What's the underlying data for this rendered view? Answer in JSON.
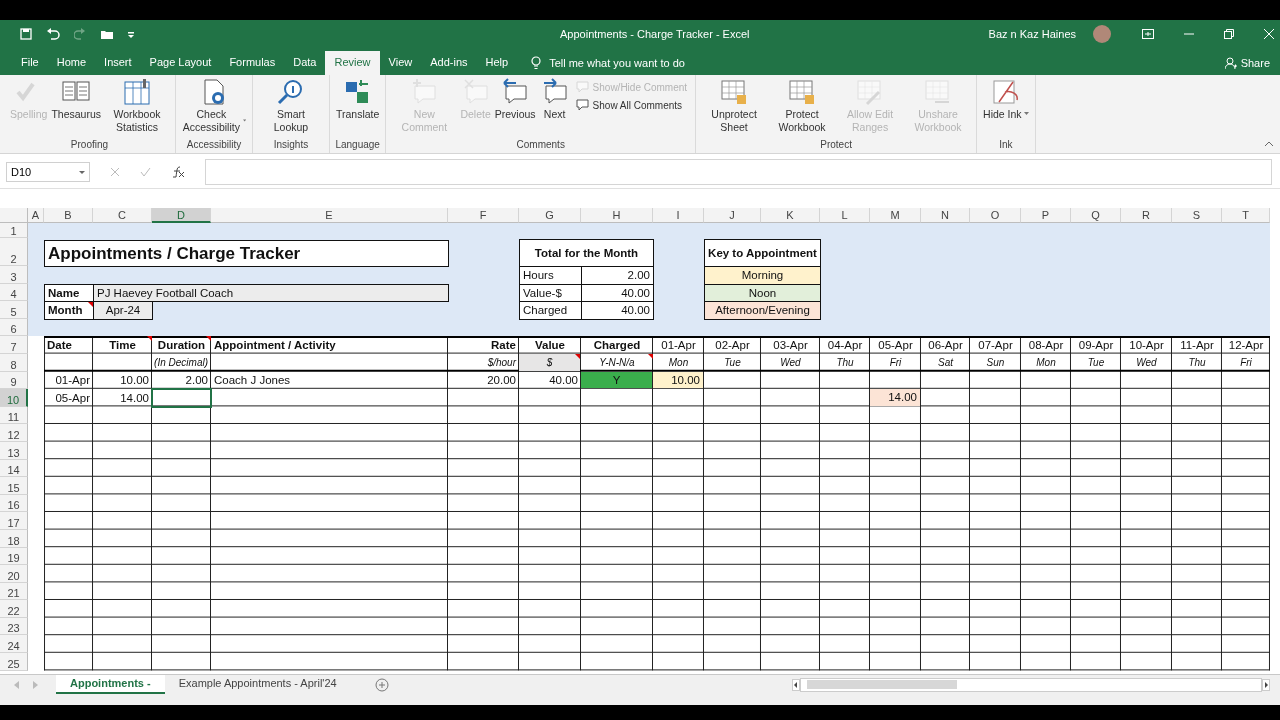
{
  "window": {
    "title": "Appointments - Charge Tracker  -  Excel",
    "user": "Baz n Kaz Haines"
  },
  "menu": {
    "tabs": [
      {
        "label": "File",
        "selected": false
      },
      {
        "label": "Home",
        "selected": false
      },
      {
        "label": "Insert",
        "selected": false
      },
      {
        "label": "Page Layout",
        "selected": false
      },
      {
        "label": "Formulas",
        "selected": false
      },
      {
        "label": "Data",
        "selected": false
      },
      {
        "label": "Review",
        "selected": true
      },
      {
        "label": "View",
        "selected": false
      },
      {
        "label": "Add-ins",
        "selected": false
      },
      {
        "label": "Help",
        "selected": false
      }
    ],
    "tell_me": "Tell me what you want to do",
    "share": "Share"
  },
  "ribbon": {
    "groups": [
      {
        "label": "Proofing",
        "buttons": [
          {
            "label": "Spelling",
            "kind": "large",
            "disabled": true
          },
          {
            "label": "Thesaurus",
            "kind": "large",
            "disabled": false
          },
          {
            "label": "Workbook Statistics",
            "kind": "large",
            "disabled": false
          }
        ]
      },
      {
        "label": "Accessibility",
        "buttons": [
          {
            "label": "Check Accessibility",
            "kind": "large",
            "disabled": false,
            "dropdown": true
          }
        ]
      },
      {
        "label": "Insights",
        "buttons": [
          {
            "label": "Smart Lookup",
            "kind": "large",
            "disabled": false
          }
        ]
      },
      {
        "label": "Language",
        "buttons": [
          {
            "label": "Translate",
            "kind": "large",
            "disabled": false
          }
        ]
      },
      {
        "label": "Comments",
        "buttons": [
          {
            "label": "New Comment",
            "kind": "large",
            "disabled": true
          },
          {
            "label": "Delete",
            "kind": "large",
            "disabled": true
          },
          {
            "label": "Previous",
            "kind": "large",
            "disabled": false
          },
          {
            "label": "Next",
            "kind": "large",
            "disabled": false
          },
          {
            "label": "Show/Hide Comment",
            "kind": "small",
            "disabled": true
          },
          {
            "label": "Show All Comments",
            "kind": "small",
            "disabled": false
          }
        ]
      },
      {
        "label": "Protect",
        "buttons": [
          {
            "label": "Unprotect Sheet",
            "kind": "large",
            "disabled": false
          },
          {
            "label": "Protect Workbook",
            "kind": "large",
            "disabled": false
          },
          {
            "label": "Allow Edit Ranges",
            "kind": "large",
            "disabled": true
          },
          {
            "label": "Unshare Workbook",
            "kind": "large",
            "disabled": true
          }
        ]
      },
      {
        "label": "Ink",
        "buttons": [
          {
            "label": "Hide Ink",
            "kind": "large",
            "disabled": false,
            "dropdown": true
          }
        ]
      }
    ]
  },
  "formula_bar": {
    "name_box": "D10"
  },
  "sheet": {
    "columns": [
      {
        "label": "A",
        "selected": false
      },
      {
        "label": "B",
        "selected": false
      },
      {
        "label": "C",
        "selected": false
      },
      {
        "label": "D",
        "selected": true
      },
      {
        "label": "E",
        "selected": false
      },
      {
        "label": "F",
        "selected": false
      },
      {
        "label": "G",
        "selected": false
      },
      {
        "label": "H",
        "selected": false
      },
      {
        "label": "I",
        "selected": false
      },
      {
        "label": "J",
        "selected": false
      },
      {
        "label": "K",
        "selected": false
      },
      {
        "label": "L",
        "selected": false
      },
      {
        "label": "M",
        "selected": false
      },
      {
        "label": "N",
        "selected": false
      },
      {
        "label": "O",
        "selected": false
      },
      {
        "label": "P",
        "selected": false
      },
      {
        "label": "Q",
        "selected": false
      },
      {
        "label": "R",
        "selected": false
      },
      {
        "label": "S",
        "selected": false
      },
      {
        "label": "T",
        "selected": false
      }
    ],
    "rows": [
      {
        "label": "1",
        "selected": false
      },
      {
        "label": "2",
        "selected": false,
        "cells": {
          "B:E": {
            "kind": "title",
            "text": "Appointments / Charge Tracker"
          },
          "G:H": {
            "kind": "box-heading",
            "text": "Total for the Month"
          },
          "J:K": {
            "kind": "box-heading",
            "text": "Key to Appointment"
          }
        }
      },
      {
        "label": "3",
        "selected": false,
        "cells": {
          "G": {
            "kind": "box-text",
            "text": "Hours"
          },
          "H": {
            "kind": "box-number",
            "text": "2.00"
          },
          "J:K": {
            "kind": "box-center",
            "text": "Morning",
            "color": "#fff2cc"
          }
        }
      },
      {
        "label": "4",
        "selected": false,
        "cells": {
          "B": {
            "kind": "box-label",
            "text": "Name"
          },
          "C:E": {
            "kind": "box-text",
            "text": "PJ Haevey Football Coach",
            "color": "#ececec"
          },
          "G": {
            "kind": "box-text",
            "text": "Value-$"
          },
          "H": {
            "kind": "box-number",
            "text": "40.00"
          },
          "J:K": {
            "kind": "box-center",
            "text": "Noon",
            "color": "#e2efda"
          }
        }
      },
      {
        "label": "5",
        "selected": false,
        "cells": {
          "B": {
            "kind": "box-label",
            "text": "Month",
            "has_comment": true
          },
          "C": {
            "kind": "box-center",
            "text": "Apr-24",
            "color": "#ececec"
          },
          "G": {
            "kind": "box-text",
            "text": "Charged"
          },
          "H": {
            "kind": "box-number",
            "text": "40.00"
          },
          "J:K": {
            "kind": "box-center",
            "text": "Afternoon/Evening",
            "color": "#fce4d6"
          }
        }
      },
      {
        "label": "6",
        "selected": false
      },
      {
        "label": "7",
        "selected": false,
        "cells": {
          "B": {
            "kind": "heading-left",
            "text": "Date"
          },
          "C": {
            "kind": "heading",
            "text": "Time",
            "has_comment": true
          },
          "D": {
            "kind": "heading",
            "text": "Duration",
            "has_comment": true
          },
          "E": {
            "kind": "heading-left",
            "text": "Appointment / Activity"
          },
          "F": {
            "kind": "heading-right",
            "text": "Rate"
          },
          "G": {
            "kind": "heading",
            "text": "Value"
          },
          "H": {
            "kind": "heading",
            "text": "Charged"
          },
          "I": {
            "kind": "center",
            "text": "01-Apr"
          },
          "J": {
            "kind": "center",
            "text": "02-Apr"
          },
          "K": {
            "kind": "center",
            "text": "03-Apr"
          },
          "L": {
            "kind": "center",
            "text": "04-Apr"
          },
          "M": {
            "kind": "center",
            "text": "05-Apr"
          },
          "N": {
            "kind": "center",
            "text": "06-Apr"
          },
          "O": {
            "kind": "center",
            "text": "07-Apr"
          },
          "P": {
            "kind": "center",
            "text": "08-Apr"
          },
          "Q": {
            "kind": "center",
            "text": "09-Apr"
          },
          "R": {
            "kind": "center",
            "text": "10-Apr"
          },
          "S": {
            "kind": "center",
            "text": "11-Apr"
          },
          "T": {
            "kind": "center",
            "text": "12-Apr"
          }
        }
      },
      {
        "label": "8",
        "selected": false,
        "cells": {
          "D": {
            "kind": "note-right",
            "text": "(In Decimal)"
          },
          "F": {
            "kind": "note-right",
            "text": "$/hour"
          },
          "G": {
            "kind": "note",
            "text": "$",
            "color": "#e7e6e6",
            "has_comment": true
          },
          "H": {
            "kind": "note",
            "text": "Y-N-N/a",
            "has_comment": true
          },
          "I": {
            "kind": "note",
            "text": "Mon"
          },
          "J": {
            "kind": "note",
            "text": "Tue"
          },
          "K": {
            "kind": "note",
            "text": "Wed"
          },
          "L": {
            "kind": "note",
            "text": "Thu"
          },
          "M": {
            "kind": "note",
            "text": "Fri"
          },
          "N": {
            "kind": "note",
            "text": "Sat"
          },
          "O": {
            "kind": "note",
            "text": "Sun"
          },
          "P": {
            "kind": "note",
            "text": "Mon"
          },
          "Q": {
            "kind": "note",
            "text": "Tue"
          },
          "R": {
            "kind": "note",
            "text": "Wed"
          },
          "S": {
            "kind": "note",
            "text": "Thu"
          },
          "T": {
            "kind": "note",
            "text": "Fri"
          }
        }
      },
      {
        "label": "9",
        "selected": false,
        "cells": {
          "B": {
            "kind": "number",
            "text": "01-Apr"
          },
          "C": {
            "kind": "number",
            "text": "10.00"
          },
          "D": {
            "kind": "number",
            "text": "2.00"
          },
          "E": {
            "kind": "text",
            "text": "Coach J Jones"
          },
          "F": {
            "kind": "number",
            "text": "20.00"
          },
          "G": {
            "kind": "number",
            "text": "40.00"
          },
          "H": {
            "kind": "center",
            "text": "Y",
            "color": "#3aae4c"
          },
          "I": {
            "kind": "number",
            "text": "10.00",
            "color": "#fff2cc"
          }
        }
      },
      {
        "label": "10",
        "selected": true,
        "cells": {
          "B": {
            "kind": "number",
            "text": "05-Apr"
          },
          "C": {
            "kind": "number",
            "text": "14.00"
          },
          "M": {
            "kind": "number",
            "text": "14.00",
            "color": "#fce4d6"
          }
        }
      },
      {
        "label": "11",
        "selected": false
      },
      {
        "label": "12",
        "selected": false
      },
      {
        "label": "13",
        "selected": false
      },
      {
        "label": "14",
        "selected": false
      },
      {
        "label": "15",
        "selected": false
      },
      {
        "label": "16",
        "selected": false
      },
      {
        "label": "17",
        "selected": false
      },
      {
        "label": "18",
        "selected": false
      },
      {
        "label": "19",
        "selected": false
      },
      {
        "label": "20",
        "selected": false
      },
      {
        "label": "21",
        "selected": false
      },
      {
        "label": "22",
        "selected": false
      },
      {
        "label": "23",
        "selected": false
      },
      {
        "label": "24",
        "selected": false
      },
      {
        "label": "25",
        "selected": false
      }
    ]
  },
  "sheet_tabs": [
    {
      "label": "Appointments -",
      "selected": true
    },
    {
      "label": "Example Appointments - April'24",
      "selected": false
    }
  ]
}
